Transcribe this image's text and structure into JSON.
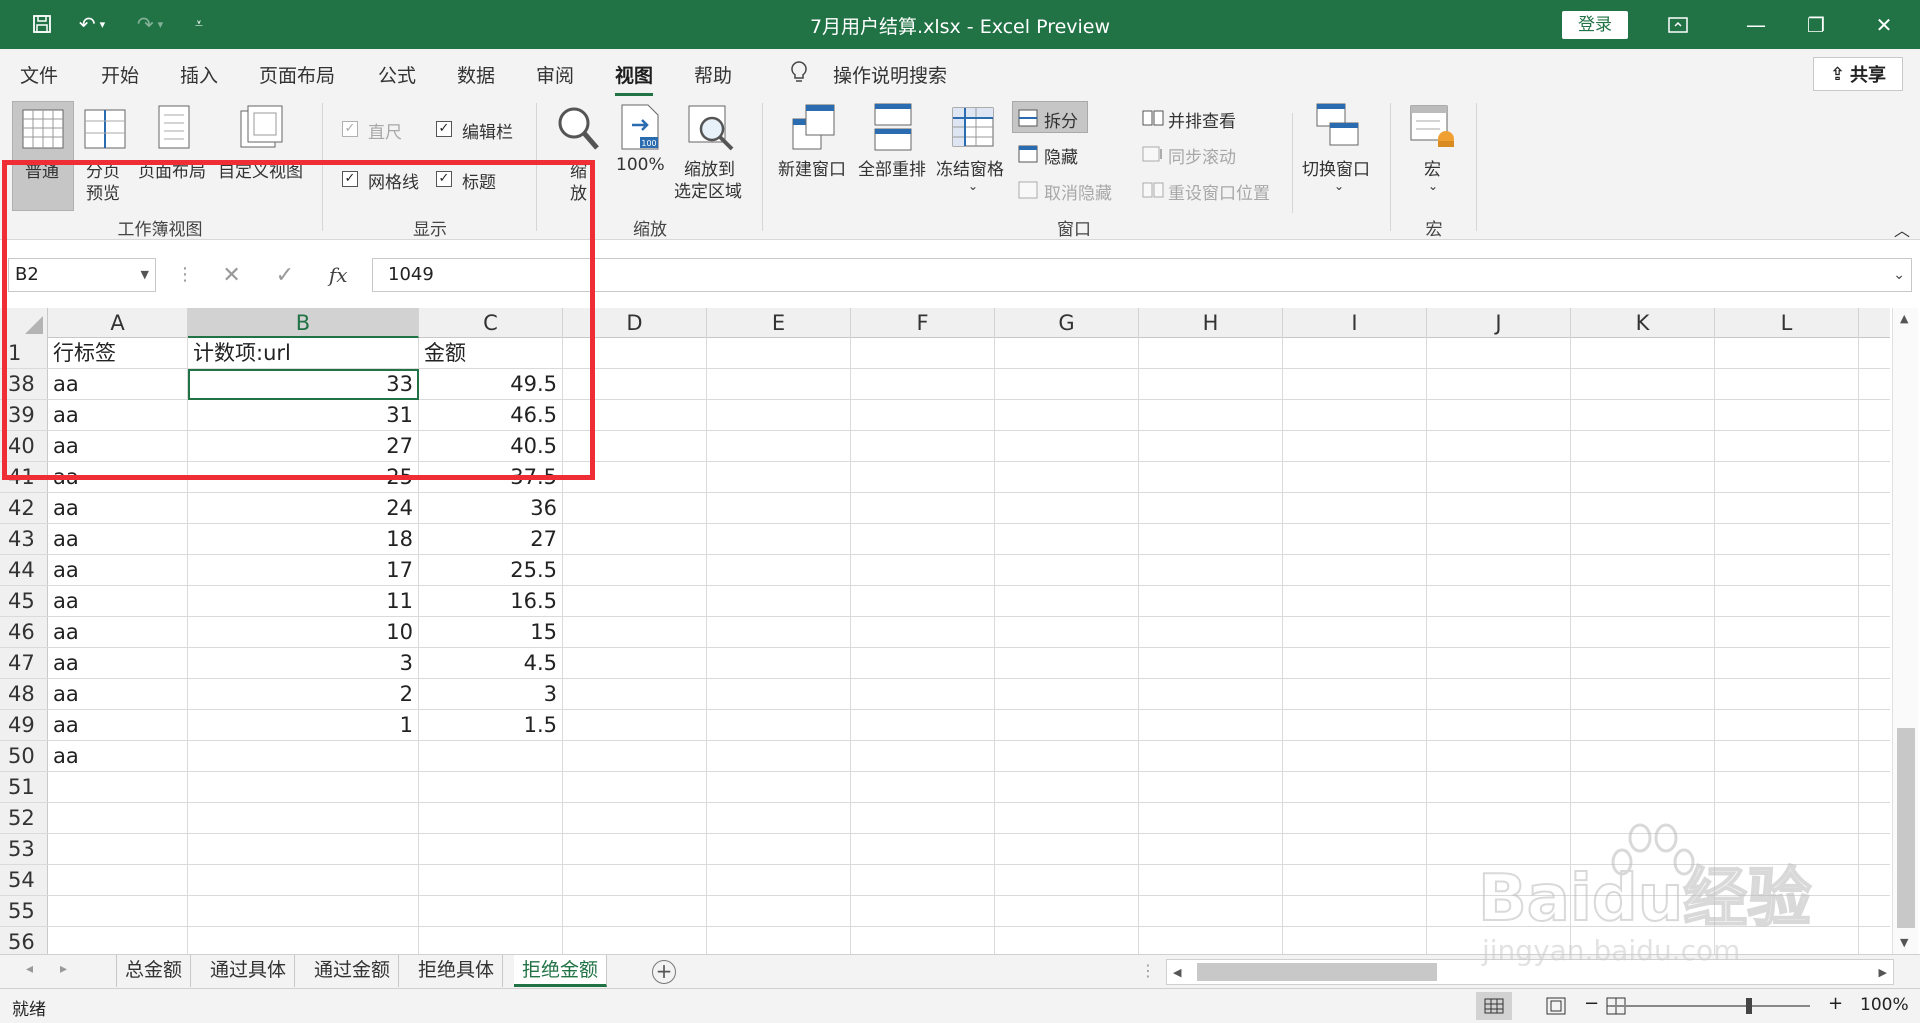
{
  "titlebar": {
    "doc_title": "7月用户结算.xlsx  -  Excel Preview",
    "login_label": "登录"
  },
  "tabs": [
    "文件",
    "开始",
    "插入",
    "页面布局",
    "公式",
    "数据",
    "审阅",
    "视图",
    "帮助"
  ],
  "active_tab": "视图",
  "tell_me": "操作说明搜索",
  "share_label": "共享",
  "ribbon": {
    "workbook_views": {
      "title": "工作簿视图",
      "normal": "普通",
      "page_break_1": "分页",
      "page_break_2": "预览",
      "page_layout": "页面布局",
      "custom_views": "自定义视图"
    },
    "show": {
      "title": "显示",
      "ruler": "直尺",
      "formula_bar": "编辑栏",
      "gridlines": "网格线",
      "headings": "标题"
    },
    "zoom": {
      "title": "缩放",
      "zoom_1": "缩",
      "zoom_2": "放",
      "zoom_100": "100%",
      "zoom_sel_1": "缩放到",
      "zoom_sel_2": "选定区域"
    },
    "window": {
      "title": "窗口",
      "new_window": "新建窗口",
      "arrange_all": "全部重排",
      "freeze_panes": "冻结窗格",
      "split": "拆分",
      "hide": "隐藏",
      "unhide": "取消隐藏",
      "side_by_side": "并排查看",
      "sync_scroll": "同步滚动",
      "reset_position": "重设窗口位置",
      "switch_windows": "切换窗口"
    },
    "macros": {
      "title": "宏",
      "macros": "宏"
    }
  },
  "formula_bar": {
    "name_box": "B2",
    "formula": "1049"
  },
  "columns": [
    "A",
    "B",
    "C",
    "D",
    "E",
    "F",
    "G",
    "H",
    "I",
    "J",
    "K",
    "L"
  ],
  "selected_column": "B",
  "rows": [
    {
      "num": "1",
      "a": "行标签",
      "b": "计数项:url",
      "c": "金额"
    },
    {
      "num": "38",
      "a": "aa",
      "b": "33",
      "c": "49.5"
    },
    {
      "num": "39",
      "a": "aa",
      "b": "31",
      "c": "46.5"
    },
    {
      "num": "40",
      "a": "aa",
      "b": "27",
      "c": "40.5"
    },
    {
      "num": "41",
      "a": "aa",
      "b": "25",
      "c": "37.5"
    },
    {
      "num": "42",
      "a": "aa",
      "b": "24",
      "c": "36"
    },
    {
      "num": "43",
      "a": "aa",
      "b": "18",
      "c": "27"
    },
    {
      "num": "44",
      "a": "aa",
      "b": "17",
      "c": "25.5"
    },
    {
      "num": "45",
      "a": "aa",
      "b": "11",
      "c": "16.5"
    },
    {
      "num": "46",
      "a": "aa",
      "b": "10",
      "c": "15"
    },
    {
      "num": "47",
      "a": "aa",
      "b": "3",
      "c": "4.5"
    },
    {
      "num": "48",
      "a": "aa",
      "b": "2",
      "c": "3"
    },
    {
      "num": "49",
      "a": "aa",
      "b": "1",
      "c": "1.5"
    },
    {
      "num": "50",
      "a": "aa",
      "b": "",
      "c": ""
    },
    {
      "num": "51",
      "a": "",
      "b": "",
      "c": ""
    },
    {
      "num": "52",
      "a": "",
      "b": "",
      "c": ""
    },
    {
      "num": "53",
      "a": "",
      "b": "",
      "c": ""
    },
    {
      "num": "54",
      "a": "",
      "b": "",
      "c": ""
    },
    {
      "num": "55",
      "a": "",
      "b": "",
      "c": ""
    },
    {
      "num": "56",
      "a": "",
      "b": "",
      "c": ""
    }
  ],
  "sheets": [
    "总金额",
    "通过具体",
    "通过金额",
    "拒绝具体",
    "拒绝金额"
  ],
  "active_sheet": "拒绝金额",
  "status": {
    "ready": "就绪",
    "zoom": "100%"
  },
  "watermark": {
    "brand": "Baidu经验",
    "url": "jingyan.baidu.com"
  },
  "colors": {
    "accent": "#217346",
    "highlight": "#ee2d35"
  }
}
